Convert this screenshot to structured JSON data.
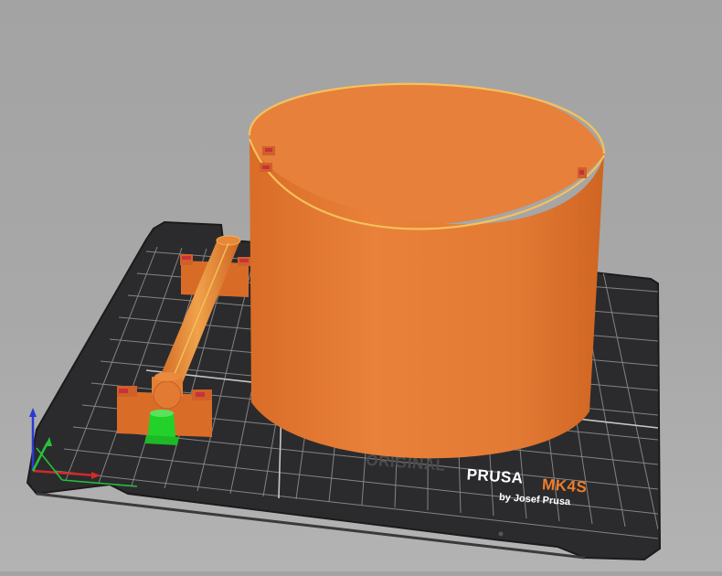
{
  "viewport": {
    "background": "#a6a6a6",
    "bed_color": "#2b2b2d",
    "grid_color": "#8a8a8a",
    "model_color": "#e07a35",
    "model_highlight": "#f3b34a",
    "selected_part_color": "#22d22a"
  },
  "bed": {
    "brand_prefix": "ORIGINAL",
    "brand_name": "PRUSA",
    "brand_model": "MK4S",
    "brand_byline": "by Josef Prusa"
  },
  "axes": {
    "x_color": "#d12a2a",
    "y_color": "#26c23a",
    "z_color": "#2a3ad1"
  },
  "objects": [
    {
      "name": "cylinder-container"
    },
    {
      "name": "rod-part"
    },
    {
      "name": "rod-support-front"
    },
    {
      "name": "rod-support-back"
    },
    {
      "name": "selected-green-part"
    }
  ]
}
